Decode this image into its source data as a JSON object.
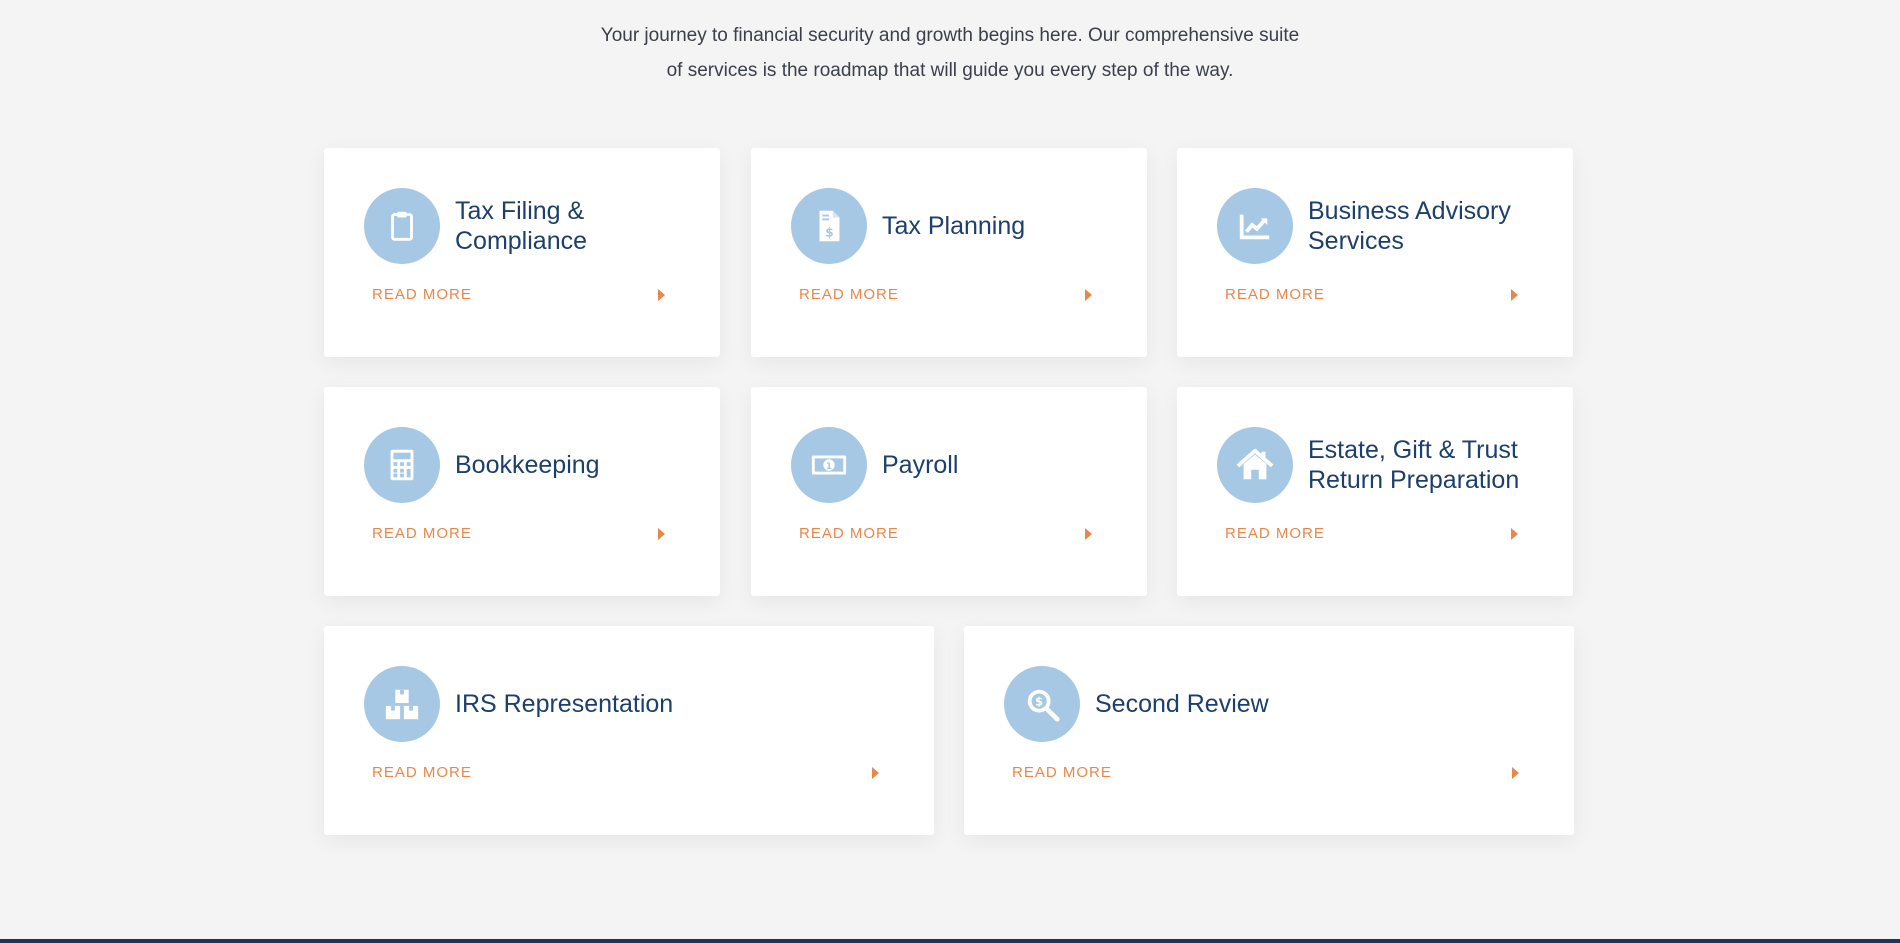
{
  "intro": {
    "line1": "Your journey to financial security and growth begins here. Our comprehensive suite",
    "line2": "of services is the roadmap that will guide you every step of the way."
  },
  "colors": {
    "background": "#f4f4f4",
    "card": "#ffffff",
    "icon_circle": "#a6c8e4",
    "title": "#1d3f6b",
    "accent": "#e8874a",
    "footer": "#1d3559"
  },
  "services": [
    {
      "title": "Tax Filing & Compliance",
      "icon": "clipboard-icon",
      "link": "READ MORE"
    },
    {
      "title": "Tax Planning",
      "icon": "invoice-dollar-icon",
      "link": "READ MORE"
    },
    {
      "title": "Business Advisory Services",
      "icon": "chart-line-icon",
      "link": "READ MORE"
    },
    {
      "title": "Bookkeeping",
      "icon": "calculator-icon",
      "link": "READ MORE"
    },
    {
      "title": "Payroll",
      "icon": "money-bill-icon",
      "link": "READ MORE"
    },
    {
      "title": "Estate, Gift & Trust Return Preparation",
      "icon": "house-icon",
      "link": "READ MORE"
    },
    {
      "title": "IRS Representation",
      "icon": "boxes-icon",
      "link": "READ MORE"
    },
    {
      "title": "Second Review",
      "icon": "search-dollar-icon",
      "link": "READ MORE"
    }
  ]
}
